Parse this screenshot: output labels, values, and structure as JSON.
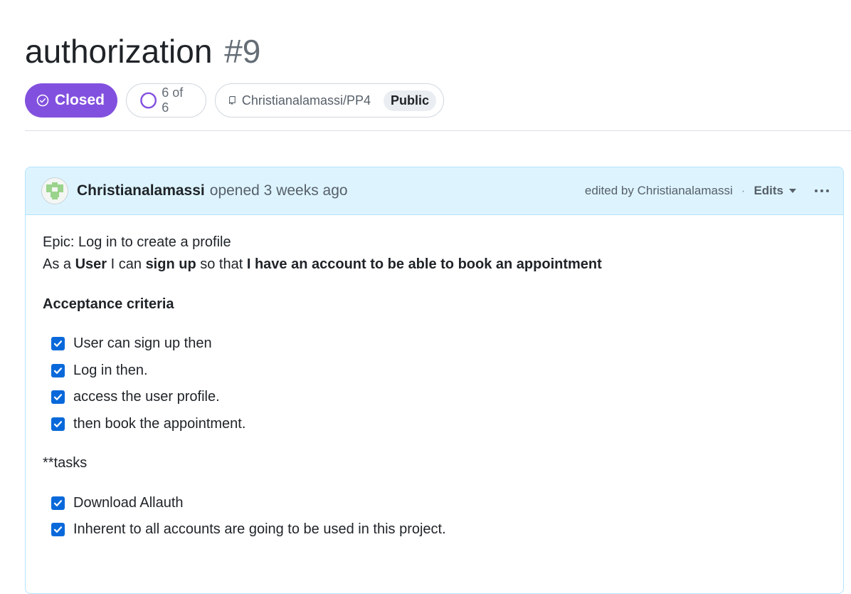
{
  "issue": {
    "title": "authorization",
    "number": "#9",
    "state": "Closed",
    "progress": "6 of 6",
    "repo": "Christianalamassi/PP4",
    "visibility": "Public"
  },
  "comment": {
    "author": "Christianalamassi",
    "opened": "opened 3 weeks ago",
    "edited_by": "edited by Christianalamassi",
    "separator": "·",
    "edits_label": "Edits",
    "body": {
      "epic": "Epic: Log in to create a profile",
      "story_prefix": "As a",
      "story_role": "User",
      "story_can": "I can",
      "story_action": "sign up",
      "story_so": "so that",
      "story_goal": "I have an account to be able to book an appointment",
      "criteria_heading": "Acceptance criteria",
      "criteria": [
        {
          "label": "User can sign up then",
          "checked": true
        },
        {
          "label": "Log in then.",
          "checked": true
        },
        {
          "label": "access the user profile.",
          "checked": true
        },
        {
          "label": "then book the appointment.",
          "checked": true
        }
      ],
      "tasks_heading": "**tasks",
      "tasks": [
        {
          "label": "Download Allauth",
          "checked": true
        },
        {
          "label": "Inherent to all accounts are going to be used in this project.",
          "checked": true
        }
      ]
    }
  },
  "colors": {
    "closed": "#8250df",
    "header_bg": "#ddf4ff",
    "checkbox": "#0969da"
  }
}
